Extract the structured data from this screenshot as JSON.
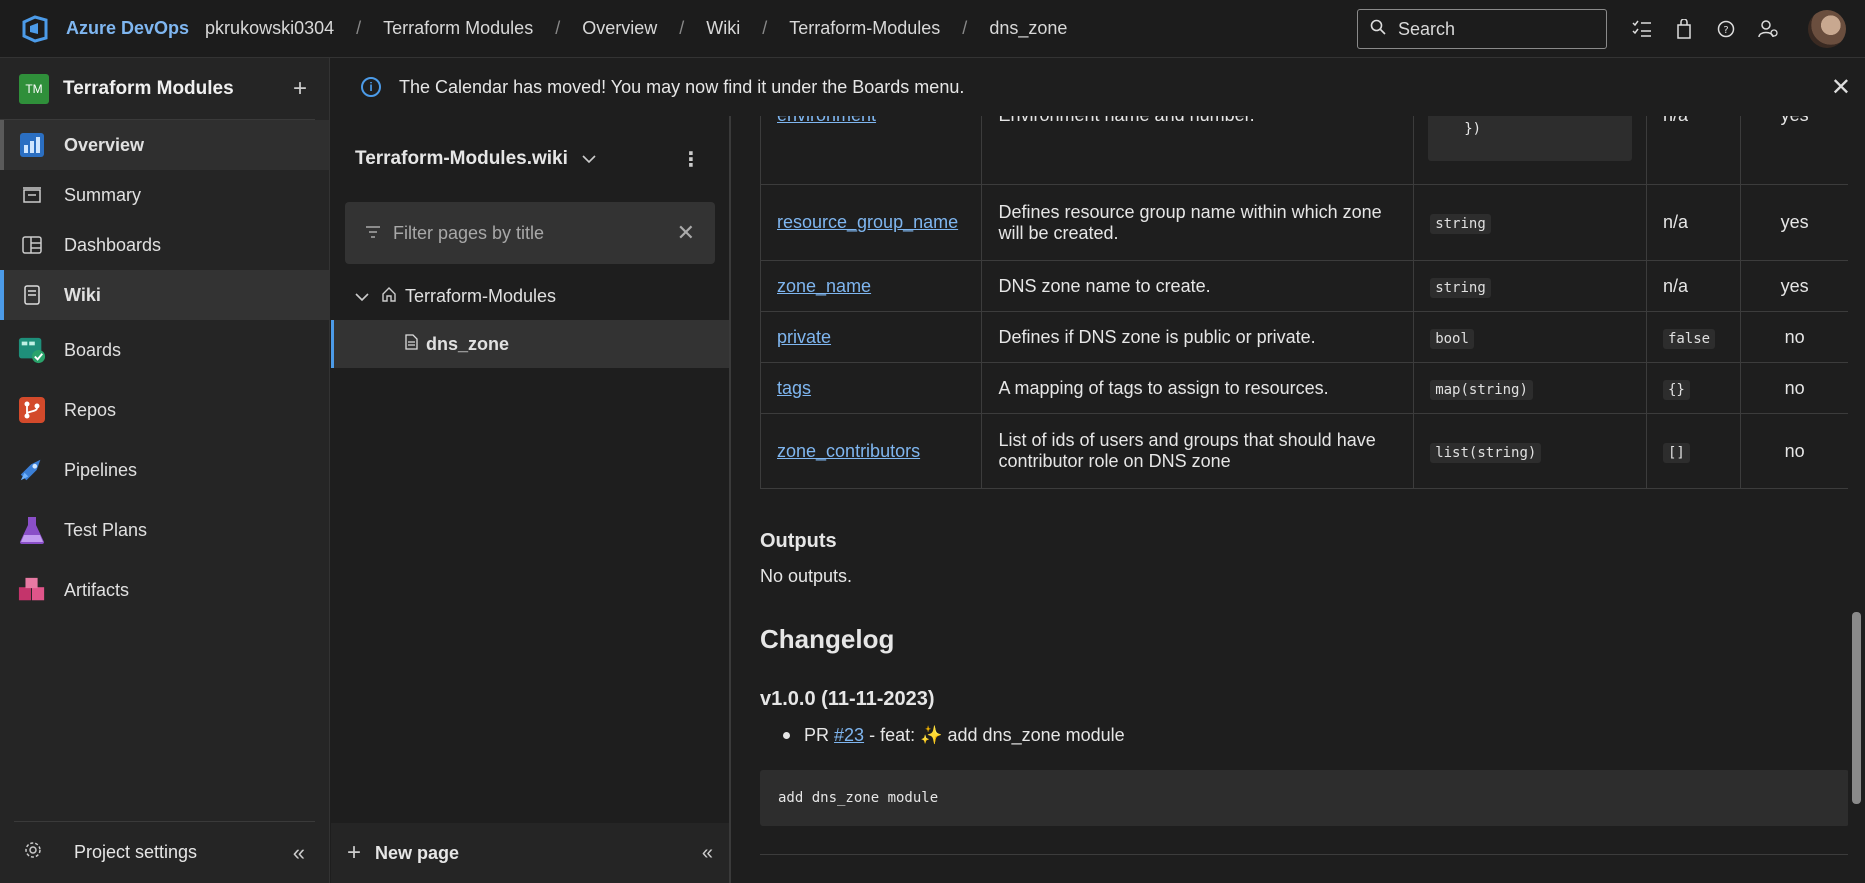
{
  "topbar": {
    "brand": "Azure DevOps",
    "breadcrumbs": [
      "pkrukowski0304",
      "Terraform Modules",
      "Overview",
      "Wiki",
      "Terraform-Modules",
      "dns_zone"
    ],
    "search_placeholder": "Search"
  },
  "project": {
    "initials": "TM",
    "name": "Terraform Modules",
    "badge_color": "#2f8f3a"
  },
  "leftnav": {
    "items": [
      {
        "label": "Overview"
      },
      {
        "label": "Summary"
      },
      {
        "label": "Dashboards"
      },
      {
        "label": "Wiki"
      },
      {
        "label": "Boards"
      },
      {
        "label": "Repos"
      },
      {
        "label": "Pipelines"
      },
      {
        "label": "Test Plans"
      },
      {
        "label": "Artifacts"
      }
    ],
    "settings_label": "Project settings"
  },
  "banner": {
    "text": "The Calendar has moved! You may now find it under the Boards menu."
  },
  "wiki": {
    "title": "Terraform-Modules.wiki",
    "filter_placeholder": "Filter pages by title",
    "tree_root": "Terraform-Modules",
    "tree_child": "dns_zone",
    "new_page_label": "New page"
  },
  "params_table": {
    "partial_row": {
      "name": "environment",
      "description": "Environment name and number.",
      "type_tail": "})",
      "default": "n/a",
      "required": "yes"
    },
    "rows": [
      {
        "name": "resource_group_name",
        "description": "Defines resource group name within which zone will be created.",
        "type": "string",
        "default": "n/a",
        "default_is_code": false,
        "required": "yes"
      },
      {
        "name": "zone_name",
        "description": "DNS zone name to create.",
        "type": "string",
        "default": "n/a",
        "default_is_code": false,
        "required": "yes"
      },
      {
        "name": "private",
        "description": "Defines if DNS zone is public or private.",
        "type": "bool",
        "default": "false",
        "default_is_code": true,
        "required": "no"
      },
      {
        "name": "tags",
        "description": "A mapping of tags to assign to resources.",
        "type": "map(string)",
        "default": "{}",
        "default_is_code": true,
        "required": "no"
      },
      {
        "name": "zone_contributors",
        "description": "List of ids of users and groups that should have contributor role on DNS zone",
        "type": "list(string)",
        "default": "[]",
        "default_is_code": true,
        "required": "no"
      }
    ]
  },
  "outputs": {
    "heading": "Outputs",
    "text": "No outputs."
  },
  "changelog": {
    "heading": "Changelog",
    "version": "v1.0.0 (11-11-2023)",
    "entry_prefix": "PR",
    "entry_link": "#23",
    "entry_text": "- feat: ✨ add dns_zone module",
    "commit_message": "add dns_zone module"
  },
  "colors": {
    "accent": "#4c9be8",
    "link": "#7fb6f0",
    "background": "#1e1e1e"
  }
}
